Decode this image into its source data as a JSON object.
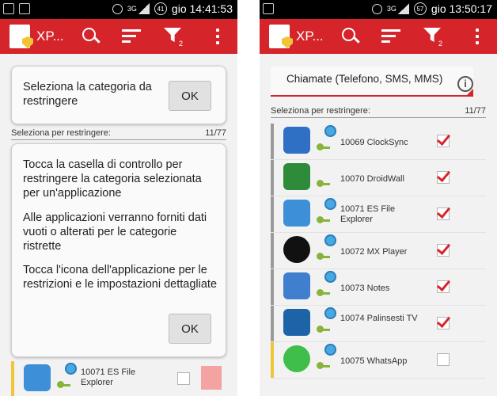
{
  "left_phone": {
    "status": {
      "network": "3G",
      "battery": "41",
      "time": "gio 14:41:53"
    },
    "app_title": "XP...",
    "filter_badge": "2",
    "dialog1": {
      "text": "Seleziona la categoria da restringere",
      "ok": "OK"
    },
    "list_header": {
      "label": "Seleziona per restringere:",
      "count": "11/77"
    },
    "dialog2": {
      "p1": "Tocca la casella di controllo per restringere la categoria selezionata per un'applicazione",
      "p2": "Alle applicazioni verranno forniti dati vuoti o alterati per le categorie ristrette",
      "p3": "Tocca l'icona dell'applicazione per le restrizioni e le impostazioni dettagliate",
      "ok": "OK"
    },
    "bottom_row": {
      "label": "10071 ES File Explorer"
    }
  },
  "right_phone": {
    "status": {
      "network": "3G",
      "battery": "57",
      "time": "gio 13:50:17"
    },
    "app_title": "XP...",
    "filter_badge": "2",
    "spinner_value": "Chiamate (Telefono, SMS, MMS)",
    "info_icon": "i",
    "list_header": {
      "label": "Seleziona per restringere:",
      "count": "11/77"
    },
    "apps": [
      {
        "label": "10069 ClockSync",
        "icon": "clocksync-icon",
        "checked": true
      },
      {
        "label": "10070 DroidWall",
        "icon": "droidwall-icon",
        "checked": true
      },
      {
        "label": "10071 ES File Explorer",
        "icon": "es-file-explorer-icon",
        "checked": true
      },
      {
        "label": "10072 MX Player",
        "icon": "mx-player-icon",
        "checked": true
      },
      {
        "label": "10073 Notes",
        "icon": "notes-icon",
        "checked": true
      },
      {
        "label": "10074 Palinsesti TV",
        "icon": "palinsesti-tv-icon",
        "checked": true
      },
      {
        "label": "10075 WhatsApp",
        "icon": "whatsapp-icon",
        "checked": false
      }
    ]
  },
  "colors": {
    "accent": "#d5252b",
    "highlight": "#f2c438"
  }
}
